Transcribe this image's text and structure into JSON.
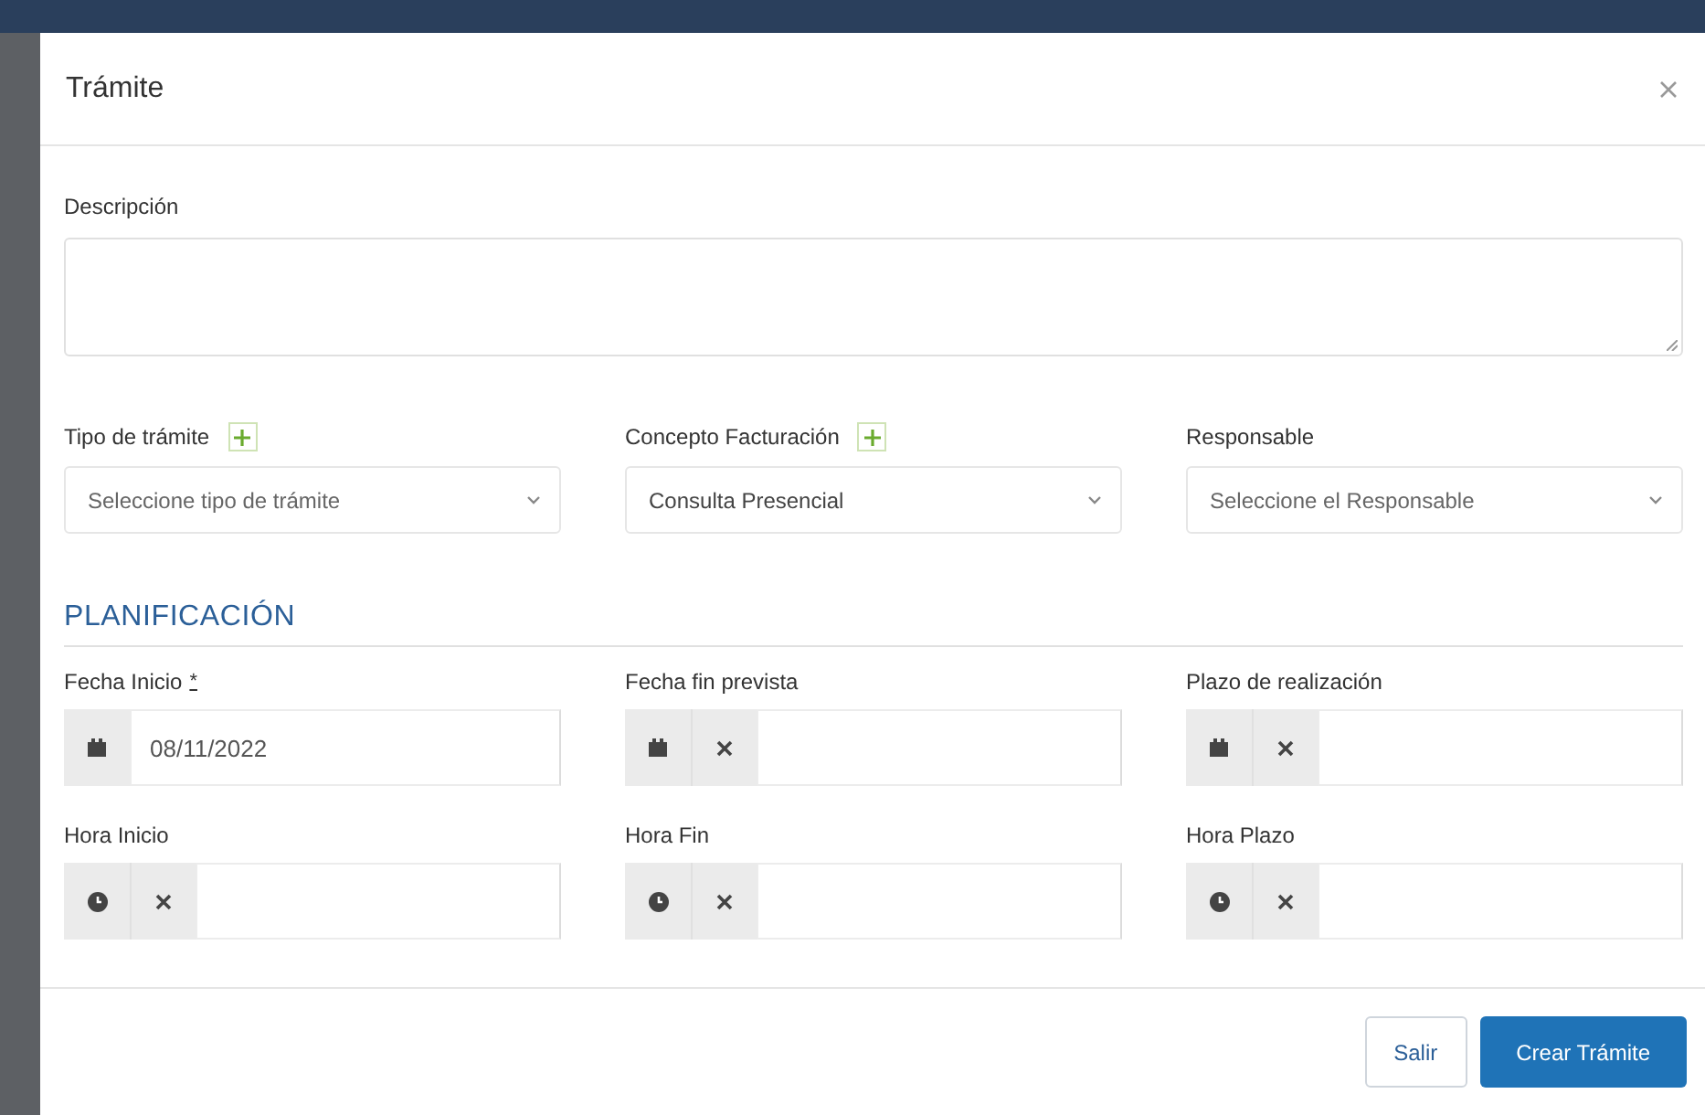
{
  "dialog": {
    "title": "Trámite"
  },
  "description": {
    "label": "Descripción"
  },
  "selects": [
    {
      "label": "Tipo de trámite",
      "addable": true,
      "placeholder": "Seleccione tipo de trámite"
    },
    {
      "label": "Concepto Facturación",
      "addable": true,
      "value": "Consulta Presencial"
    },
    {
      "label": "Responsable",
      "addable": false,
      "placeholder": "Seleccione el Responsable"
    }
  ],
  "section": {
    "title": "PLANIFICACIÓN"
  },
  "pickers": [
    {
      "label": "Fecha Inicio",
      "required_mark": "*",
      "kind": "date",
      "clearable": false,
      "value": "08/11/2022"
    },
    {
      "label": "Fecha fin prevista",
      "kind": "date",
      "clearable": true
    },
    {
      "label": "Plazo de realización",
      "kind": "date",
      "clearable": true
    },
    {
      "label": "Hora Inicio",
      "kind": "time",
      "clearable": true
    },
    {
      "label": "Hora Fin",
      "kind": "time",
      "clearable": true
    },
    {
      "label": "Hora Plazo",
      "kind": "time",
      "clearable": true
    }
  ],
  "buttons": [
    {
      "label": "Salir",
      "kind": "secondary"
    },
    {
      "label": "Crear Trámite",
      "kind": "primary"
    }
  ]
}
